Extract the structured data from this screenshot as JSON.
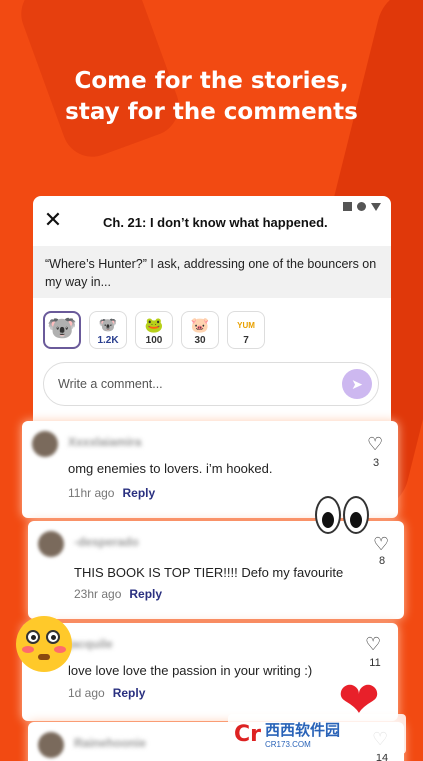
{
  "headline": {
    "line1": "Come for the stories,",
    "line2": "stay for the comments"
  },
  "reader": {
    "chapter_title": "Ch. 21: I don’t know what happened.",
    "quote": "“Where’s Hunter?” I ask, addressing one of the bouncers on my way in...",
    "reactions": [
      {
        "icon": "koala-sticker-icon",
        "count": ""
      },
      {
        "icon": "koala-sticker-icon",
        "count": "1.2K"
      },
      {
        "icon": "frog-sticker-icon",
        "count": "100"
      },
      {
        "icon": "pig-sticker-icon",
        "count": "30"
      },
      {
        "icon": "yummy-sticker-icon",
        "count": "7"
      }
    ],
    "comment_placeholder": "Write a comment..."
  },
  "comments": [
    {
      "username": "Xxxxlaiamira",
      "text": "omg enemies to lovers. i’m hooked.",
      "time": "11hr ago",
      "reply_label": "Reply",
      "likes": "3"
    },
    {
      "username": "-desperado",
      "text": "THIS BOOK IS TOP TIER!!!! Defo my favourite",
      "time": "23hr ago",
      "reply_label": "Reply",
      "likes": "8"
    },
    {
      "username": "jacquile",
      "text": "love love love the passion in your writing :)",
      "time": "1d ago",
      "reply_label": "Reply",
      "likes": "11"
    },
    {
      "username": "Rainehoonie",
      "text": "",
      "time": "",
      "reply_label": "",
      "likes": "14"
    }
  ],
  "watermark": {
    "logo": "Cr",
    "main": "西西软件园",
    "sub": "CR173.COM"
  },
  "colors": {
    "background": "#f24a12",
    "reply": "#2a3080",
    "send": "#cdb8f0"
  }
}
